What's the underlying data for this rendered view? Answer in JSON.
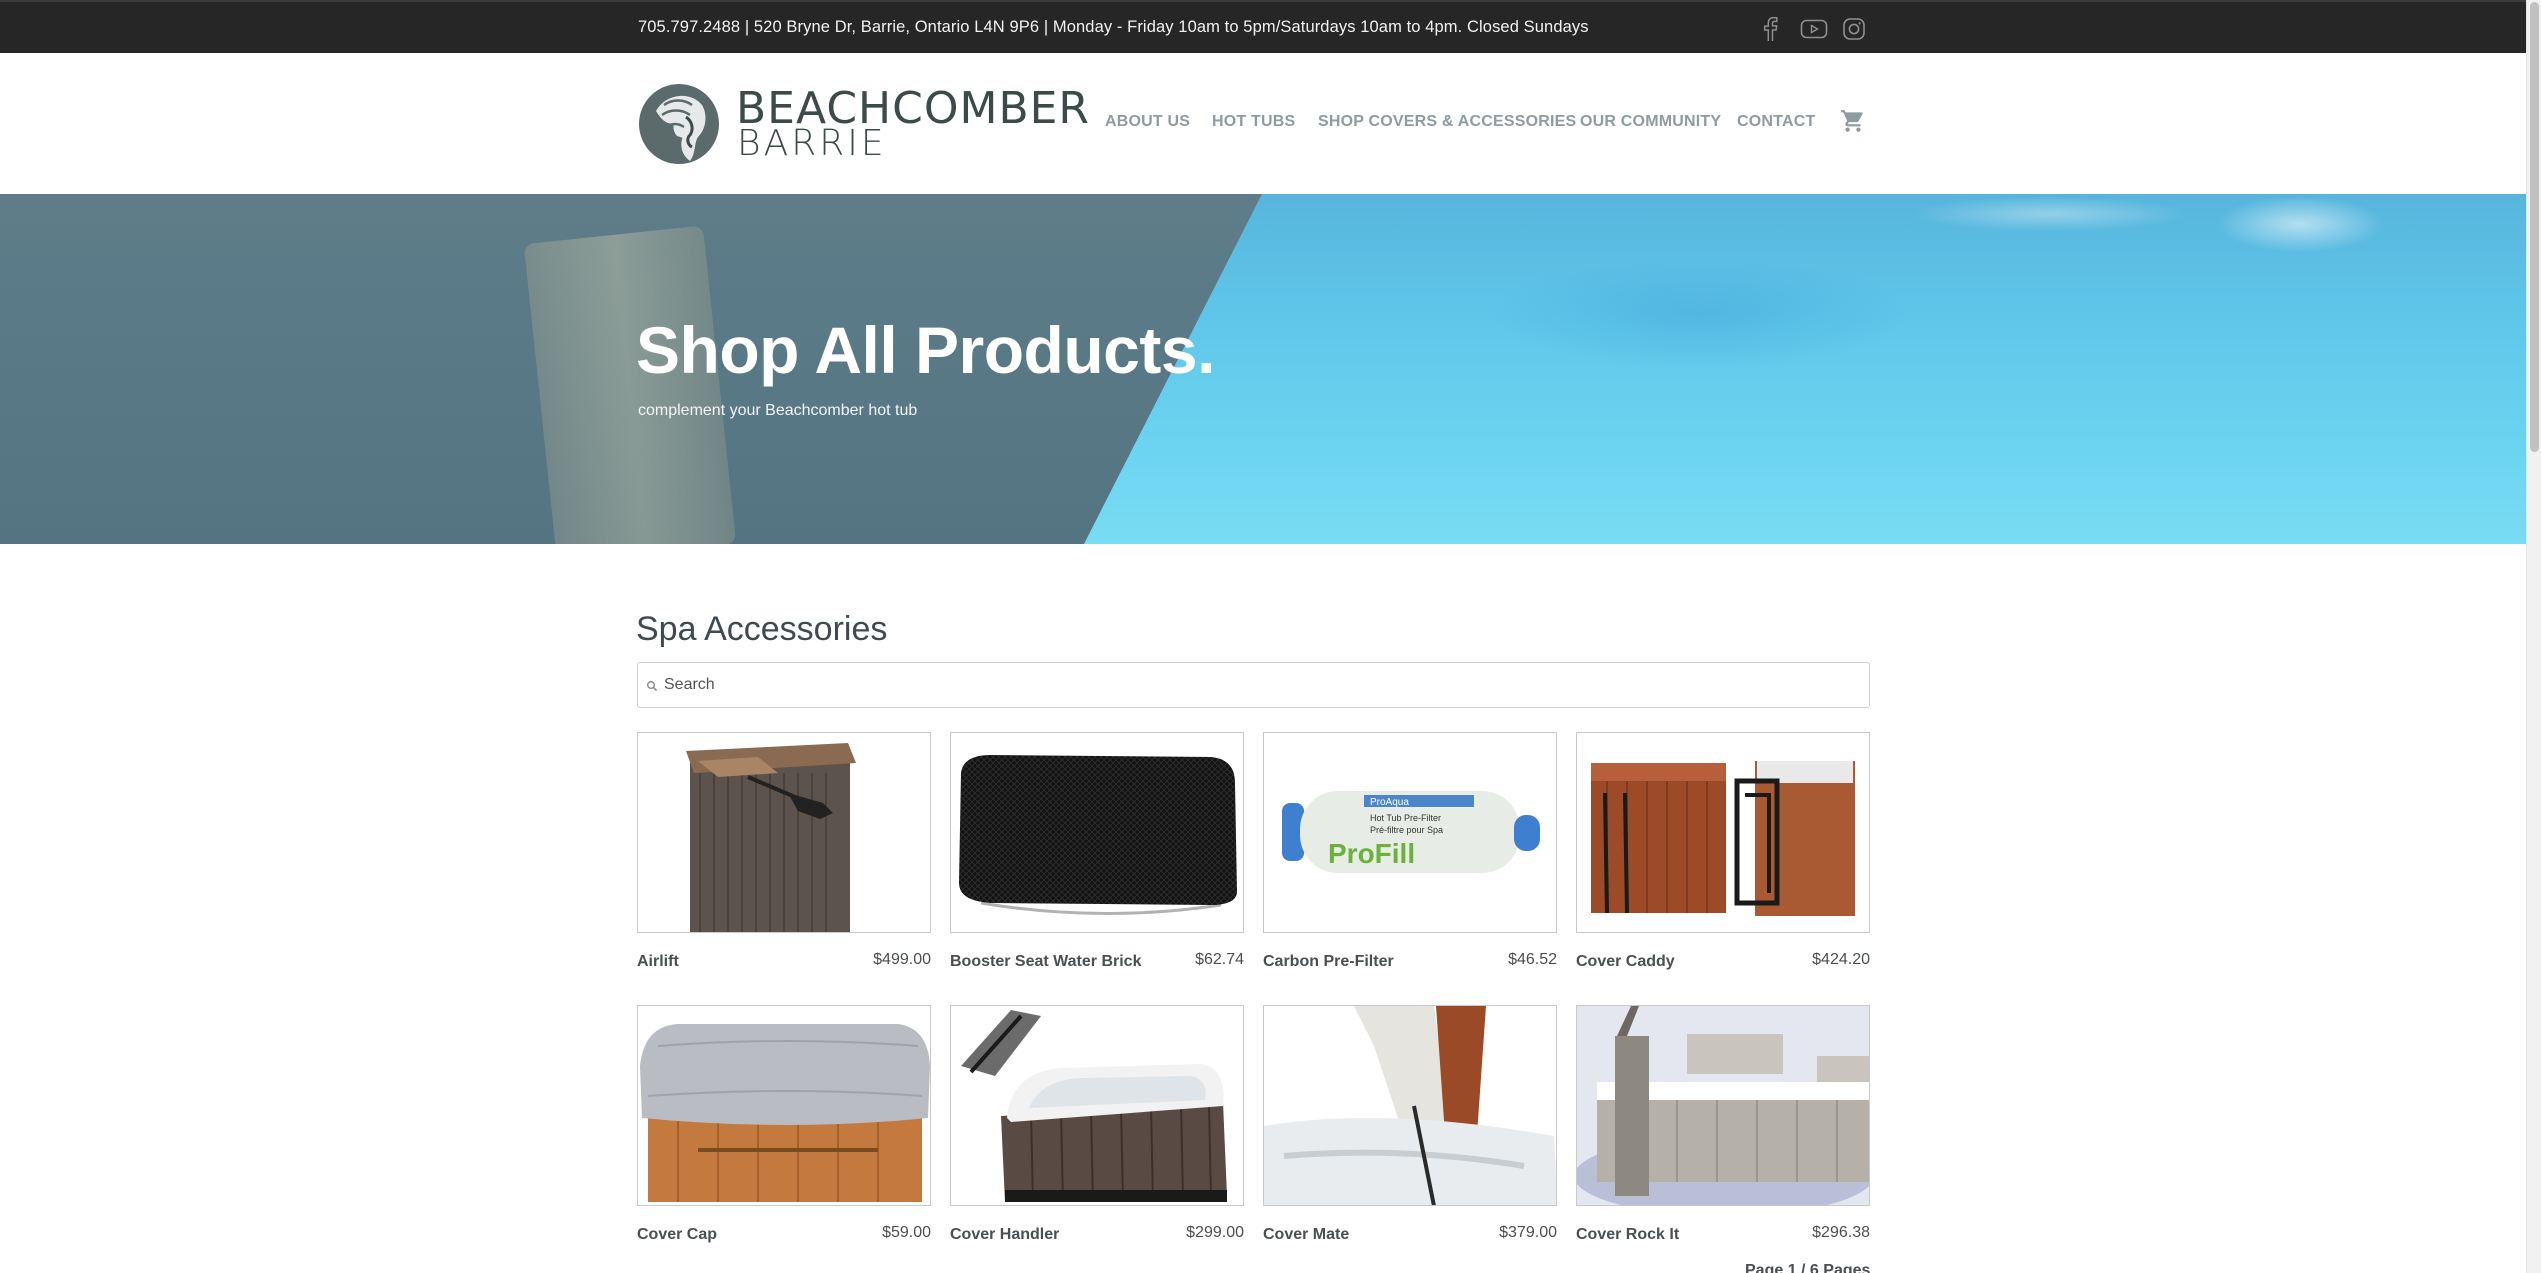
{
  "topbar": {
    "info": "705.797.2488 | 520 Bryne Dr, Barrie, Ontario L4N 9P6 | Monday - Friday 10am to 5pm/Saturdays 10am to 4pm. Closed Sundays",
    "social": [
      "facebook-icon",
      "youtube-icon",
      "instagram-icon"
    ]
  },
  "header": {
    "logo_line1": "BEACHCOMBER",
    "logo_line2": "BARRIE",
    "nav": [
      {
        "label": "ABOUT US"
      },
      {
        "label": "HOT TUBS"
      },
      {
        "label": "SHOP COVERS & ACCESSORIES"
      },
      {
        "label": "OUR COMMUNITY"
      },
      {
        "label": "CONTACT"
      }
    ],
    "cart_icon": "cart-icon"
  },
  "hero": {
    "title": "Shop All Products.",
    "subtitle": "complement your Beachcomber hot tub"
  },
  "main": {
    "section_title": "Spa Accessories",
    "search": {
      "placeholder": "Search",
      "value": ""
    },
    "products": [
      {
        "name": "Airlift",
        "price": "$499.00"
      },
      {
        "name": "Booster Seat Water Brick",
        "price": "$62.74"
      },
      {
        "name": "Carbon Pre-Filter",
        "price": "$46.52"
      },
      {
        "name": "Cover Caddy",
        "price": "$424.20"
      },
      {
        "name": "Cover Cap",
        "price": "$59.00"
      },
      {
        "name": "Cover Handler",
        "price": "$299.00"
      },
      {
        "name": "Cover Mate",
        "price": "$379.00"
      },
      {
        "name": "Cover Rock It",
        "price": "$296.38"
      }
    ],
    "pager": "Page 1 / 6 Pages"
  },
  "colors": {
    "topbar_bg": "#262626",
    "nav_text": "#8e9ba1",
    "logo_text": "#3c4a4a",
    "hero_water": "#5fc6ea",
    "hero_overlay": "#5f7882"
  }
}
